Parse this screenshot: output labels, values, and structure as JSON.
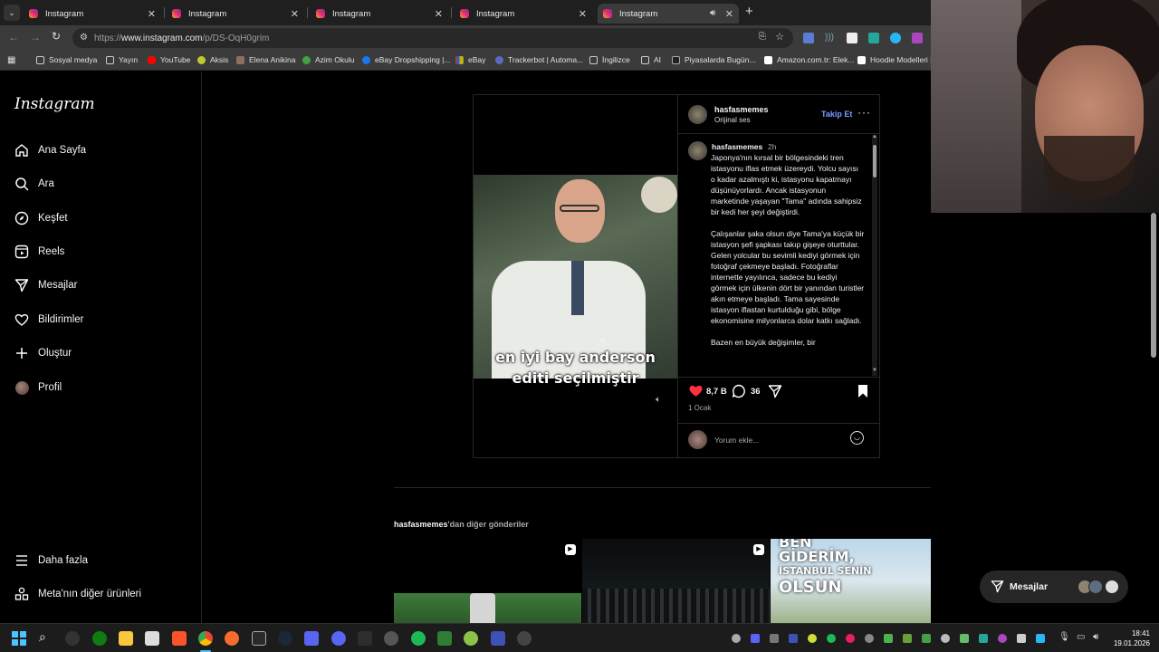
{
  "browser": {
    "tabs": [
      {
        "title": "Instagram"
      },
      {
        "title": "Instagram"
      },
      {
        "title": "Instagram"
      },
      {
        "title": "Instagram"
      },
      {
        "title": "Instagram"
      }
    ],
    "new_tab_label": "+",
    "url_prefix": "https://",
    "url_host": "www.instagram.com",
    "url_path": "/p/DS-OqH0grim",
    "bookmarks": [
      "Sosyal medya",
      "Yayın",
      "YouTube",
      "Aksis",
      "Elena Anikina",
      "Azim Okulu",
      "eBay Dropshipping |...",
      "eBay",
      "Trackerbot | Automa...",
      "İngilizce",
      "AI",
      "Piyasalarda Bugün...",
      "Amazon.com.tr: Elek...",
      "Hoodie Modelleri |"
    ]
  },
  "instagram": {
    "logo": "Instagram",
    "nav": [
      {
        "label": "Ana Sayfa",
        "icon": "home-icon"
      },
      {
        "label": "Ara",
        "icon": "search-icon"
      },
      {
        "label": "Keşfet",
        "icon": "compass-icon"
      },
      {
        "label": "Reels",
        "icon": "reels-icon"
      },
      {
        "label": "Mesajlar",
        "icon": "send-icon"
      },
      {
        "label": "Bildirimler",
        "icon": "heart-icon"
      },
      {
        "label": "Oluştur",
        "icon": "plus-icon"
      },
      {
        "label": "Profil",
        "icon": "avatar-icon"
      }
    ],
    "more": "Daha fazla",
    "meta": "Meta'nın diğer ürünleri"
  },
  "post": {
    "username": "hasfasmemes",
    "audio": "Orijinal ses",
    "follow": "Takip Et",
    "caption_user": "hasfasmemes",
    "caption_time": "2h",
    "caption": "Japonya'nın kırsal bir bölgesindeki tren istasyonu iflas etmek üzereydi. Yolcu sayısı o kadar azalmıştı ki, istasyonu kapatmayı düşünüyorlardı. Ancak istasyonun marketinde yaşayan \"Tama\" adında sahipsiz bir kedi her şeyi değiştirdi.\n\nÇalışanlar şaka olsun diye Tama'ya küçük bir istasyon şefi şapkası takıp gişeye oturttular. Gelen yolcular bu sevimli kediyi görmek için fotoğraf çekmeye başladı. Fotoğraflar internette yayılınca, sadece bu kediyi görmek için ülkenin dört bir yanından turistler akın etmeye başladı. Tama sayesinde istasyon iflastan kurtulduğu gibi, bölge ekonomisine milyonlarca dolar katkı sağladı.\n\nBazen en büyük değişimler, bir",
    "video_caption_line1": "en iyi bay anderson",
    "video_caption_line2": "editi seçilmiştir",
    "likes": "8,7 B",
    "comments": "36",
    "date": "1 Ocak",
    "comment_placeholder": "Yorum ekle..."
  },
  "more_posts": {
    "user": "hasfasmemes",
    "suffix": "'dan diğer gönderiler",
    "thumb3_line1": "BEN",
    "thumb3_line2": "GİDERİM,",
    "thumb3_line3": "İSTANBUL SENİN",
    "thumb3_line4": "OLSUN"
  },
  "messages_bubble": "Mesajlar",
  "taskbar": {
    "time": "18:41",
    "date": "19.01.2026"
  },
  "colors": {
    "ig_blue": "#0095f6",
    "follow_blue": "#4a7bff",
    "heart_red": "#ff3040",
    "page_bg": "#000000"
  }
}
